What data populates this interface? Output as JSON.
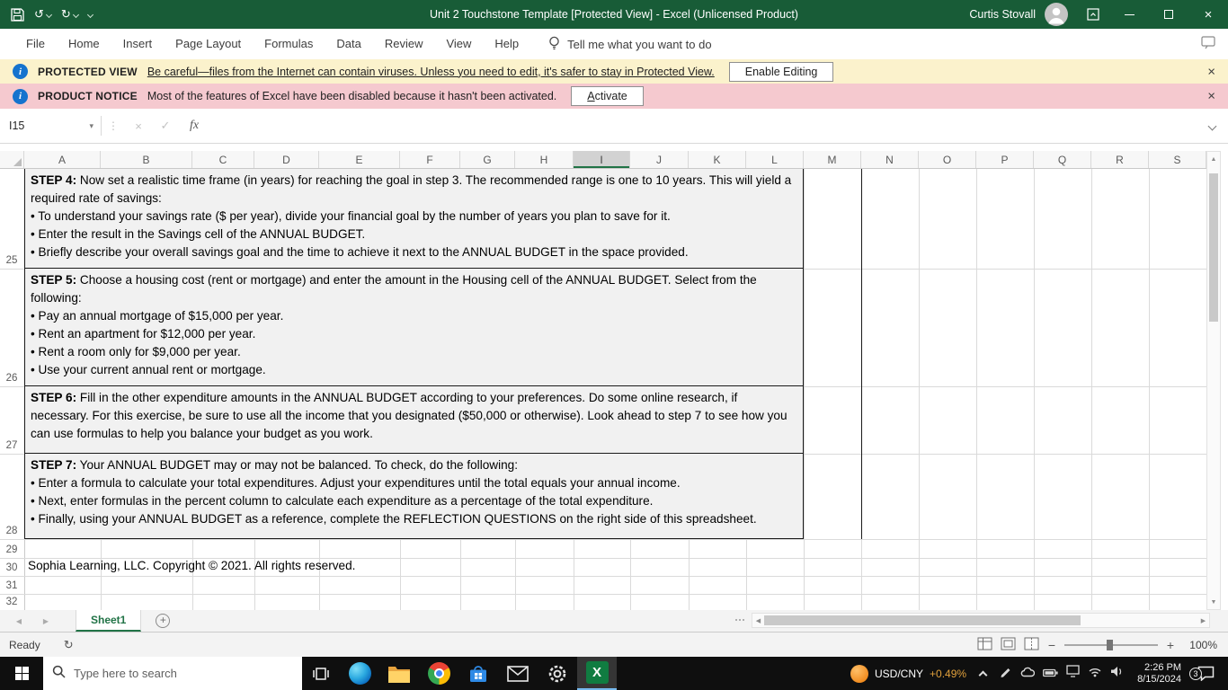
{
  "window": {
    "title": "Unit 2 Touchstone Template  [Protected View]  -  Excel (Unlicensed Product)",
    "user_name": "Curtis Stovall"
  },
  "ribbon": {
    "tabs": [
      "File",
      "Home",
      "Insert",
      "Page Layout",
      "Formulas",
      "Data",
      "Review",
      "View",
      "Help"
    ],
    "tell_me": "Tell me what you want to do"
  },
  "notices": {
    "protected": {
      "label": "PROTECTED VIEW",
      "message": "Be careful—files from the Internet can contain viruses. Unless you need to edit, it's safer to stay in Protected View.",
      "button": "Enable Editing"
    },
    "product": {
      "label": "PRODUCT NOTICE",
      "message": "Most of the features of Excel have been disabled because it hasn't been activated.",
      "button": "Activate"
    }
  },
  "formula_bar": {
    "name_box": "I15",
    "fx": "fx"
  },
  "grid": {
    "columns": [
      "A",
      "B",
      "C",
      "D",
      "E",
      "F",
      "G",
      "H",
      "I",
      "J",
      "K",
      "L",
      "M",
      "N",
      "O",
      "P",
      "Q",
      "R",
      "S"
    ],
    "selected_column": "I",
    "rows": [
      "25",
      "26",
      "27",
      "28",
      "29",
      "30",
      "31",
      "32"
    ],
    "steps": [
      {
        "label": "STEP 4:",
        "intro": "Now set a realistic time frame (in years) for reaching the goal in step 3. The recommended range is one to 10 years. This will yield a required rate of savings:",
        "bullets": [
          "• To understand your savings rate ($ per year), divide your financial goal by the number of years you plan to save for it.",
          "• Enter the result in the Savings cell of the ANNUAL BUDGET.",
          "• Briefly describe your overall savings goal and the time to achieve it next to the ANNUAL BUDGET in the space provided."
        ]
      },
      {
        "label": "STEP 5:",
        "intro": "Choose a housing cost (rent or mortgage) and enter the amount in the Housing cell of the ANNUAL BUDGET. Select from the following:",
        "bullets": [
          "• Pay an annual mortgage of $15,000 per year.",
          "• Rent an apartment for $12,000 per year.",
          "• Rent a room only for $9,000 per year.",
          "• Use your current annual rent or mortgage."
        ]
      },
      {
        "label": "STEP 6:",
        "intro": "Fill in the other expenditure amounts in the ANNUAL BUDGET according to your preferences. Do some online research, if necessary. For this exercise, be sure to use all the income that you designated ($50,000 or otherwise). Look ahead to step 7 to see how you can use formulas to help you balance your budget as you work.",
        "bullets": []
      },
      {
        "label": "STEP 7:",
        "intro": "Your ANNUAL BUDGET may or may not be balanced. To check, do the following:",
        "bullets": [
          "• Enter a formula to calculate your total expenditures. Adjust your expenditures until the total equals your annual income.",
          "• Next, enter formulas in the percent column to calculate each expenditure as a percentage of the total expenditure.",
          "• Finally, using your ANNUAL BUDGET as a reference, complete the REFLECTION QUESTIONS on the right side of this spreadsheet."
        ]
      }
    ],
    "copyright": "Sophia Learning, LLC. Copyright © 2021. All rights reserved."
  },
  "sheet_bar": {
    "tab": "Sheet1"
  },
  "status_bar": {
    "status": "Ready",
    "zoom": "100%"
  },
  "taskbar": {
    "search_placeholder": "Type here to search",
    "ticker_pair": "USD/CNY",
    "ticker_change": "+0.49%",
    "time": "2:26 PM",
    "date": "8/15/2024",
    "notification_count": "3"
  },
  "glyphs": {
    "undo": "↺",
    "redo": "↻",
    "close": "×",
    "cancel": "×",
    "check": "✓",
    "separator": "⋮",
    "caret": "▾",
    "up": "▲",
    "down": "▼",
    "left": "◀",
    "right": "▶",
    "add": "+",
    "minus": "−",
    "plus": "+"
  },
  "colors": {
    "titlebar_green": "#185C37",
    "accent_green": "#217346",
    "protected_bar_bg": "#FBF2CC",
    "product_bar_bg": "#F5C9CF",
    "ticker_change_color": "#E2A13C"
  }
}
